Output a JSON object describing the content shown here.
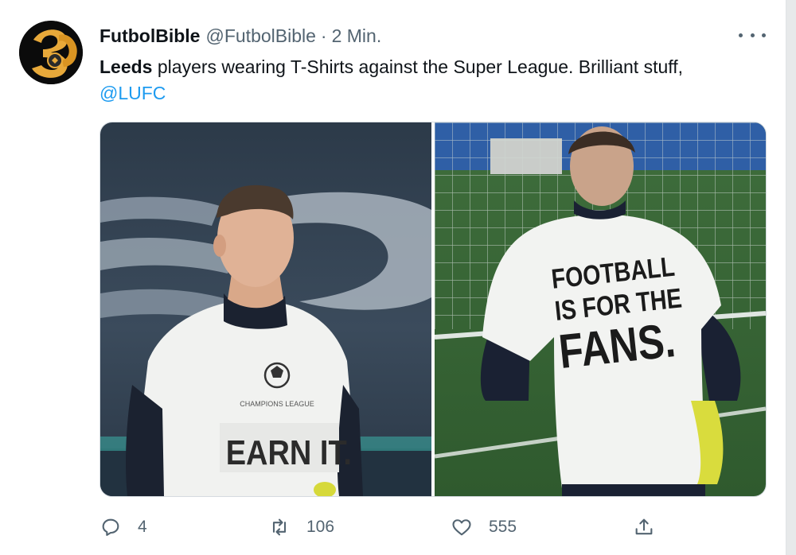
{
  "tweet": {
    "display_name": "FutbolBible",
    "handle": "@FutbolBible",
    "separator": "·",
    "time": "2 Min.",
    "text_bold": "Leeds",
    "text_rest": " players wearing T-Shirts against the Super League. Brilliant stuff,",
    "mention": "@LUFC"
  },
  "media": {
    "left_shirt_text": "EARN IT.",
    "left_shirt_logo_text": "CHAMPIONS LEAGUE",
    "right_shirt_lines": [
      "FOOTBALL",
      "IS FOR THE",
      "FANS."
    ]
  },
  "actions": {
    "reply_count": "4",
    "retweet_count": "106",
    "like_count": "555"
  },
  "colors": {
    "link": "#1d9bf0",
    "muted": "#536471"
  },
  "icons": [
    "more-icon",
    "reply-icon",
    "retweet-icon",
    "like-icon",
    "share-icon"
  ]
}
